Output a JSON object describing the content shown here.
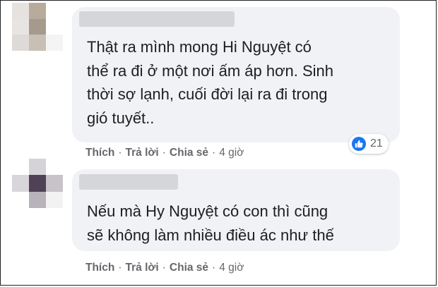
{
  "comments": [
    {
      "text": "Thật ra mình mong Hi Nguyệt có\nthể ra đi ở một nơi ấm áp hơn. Sinh\nthời sợ lạnh, cuối đời lại ra đi trong\ngió tuyết..",
      "actions": {
        "like": "Thích",
        "reply": "Trả lời",
        "share": "Chia sẻ",
        "time": "4 giờ"
      },
      "reactions": {
        "icon": "like-icon",
        "count": "21"
      }
    },
    {
      "text": "Nếu mà Hy Nguyệt có con thì cũng\nsẽ không làm nhiều điều ác như thế",
      "actions": {
        "like": "Thích",
        "reply": "Trả lời",
        "share": "Chia sẻ",
        "time": "4 giờ"
      }
    }
  ],
  "separator": "·",
  "colors": {
    "bubble": "#f0f2f5",
    "text": "#1c1e21",
    "meta": "#65676b",
    "like_blue": "#1877f2"
  }
}
